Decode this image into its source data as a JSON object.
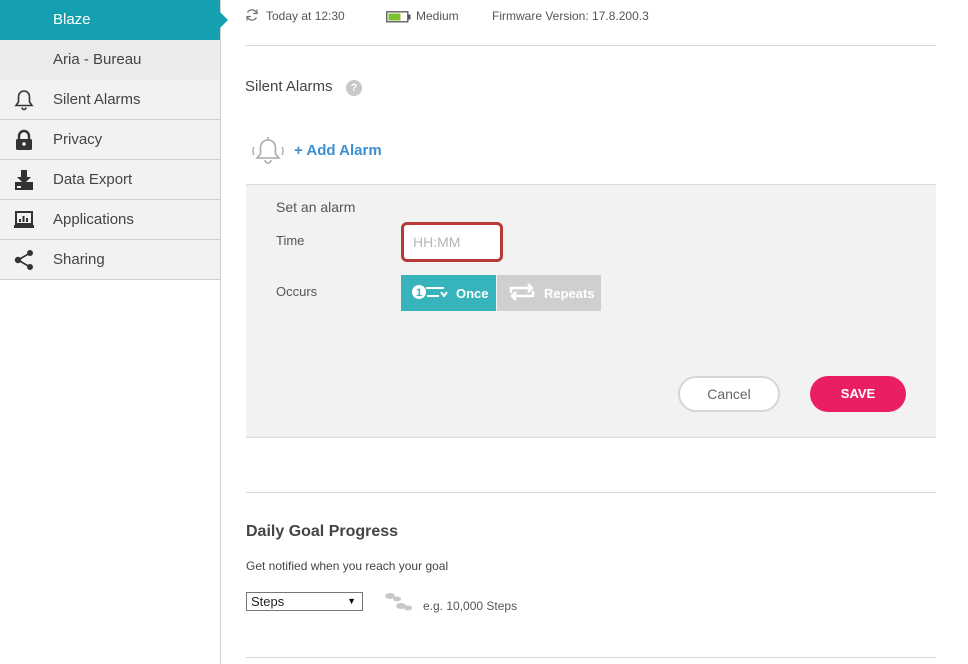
{
  "sidebar": {
    "active_device": "Blaze",
    "other_device": "Aria - Bureau",
    "items": [
      {
        "label": "Silent Alarms",
        "icon": "bell-icon"
      },
      {
        "label": "Privacy",
        "icon": "lock-icon"
      },
      {
        "label": "Data Export",
        "icon": "download-icon"
      },
      {
        "label": "Applications",
        "icon": "laptop-icon"
      },
      {
        "label": "Sharing",
        "icon": "share-icon"
      }
    ]
  },
  "status": {
    "sync": "Today at 12:30",
    "battery": "Medium",
    "firmware": "Firmware Version: 17.8.200.3"
  },
  "silent_alarms": {
    "title": "Silent Alarms",
    "help": "?",
    "add_alarm": "+ Add Alarm",
    "form": {
      "title": "Set an alarm",
      "time_label": "Time",
      "time_placeholder": "HH:MM",
      "occurs_label": "Occurs",
      "once": "Once",
      "repeats": "Repeats",
      "cancel": "Cancel",
      "save": "SAVE"
    }
  },
  "daily_goal": {
    "title": "Daily Goal Progress",
    "description": "Get notified when you reach your goal",
    "selected": "Steps",
    "example": "e.g. 10,000 Steps"
  },
  "colors": {
    "accent": "#14a0b0",
    "save": "#ea1f63",
    "link": "#3d8fd1",
    "error_border": "#b83a36"
  }
}
